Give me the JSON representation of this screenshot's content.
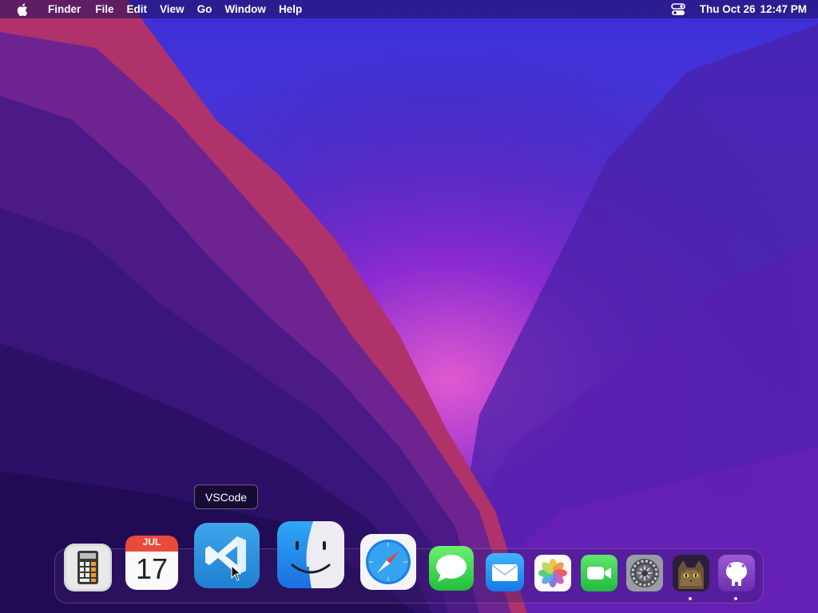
{
  "menubar": {
    "app_name": "Finder",
    "menus": [
      "File",
      "Edit",
      "View",
      "Go",
      "Window",
      "Help"
    ],
    "clock_day": "Thu Oct 26",
    "clock_time": "12:47 PM"
  },
  "tooltip": {
    "label": "VSCode"
  },
  "calendar": {
    "month": "JUL",
    "day": "17"
  },
  "dock": {
    "items": [
      {
        "name": "calculator",
        "icon": "calculator-icon"
      },
      {
        "name": "calendar",
        "icon": "calendar-icon"
      },
      {
        "name": "vscode",
        "icon": "vscode-icon"
      },
      {
        "name": "finder",
        "icon": "finder-icon"
      },
      {
        "name": "safari",
        "icon": "safari-icon"
      },
      {
        "name": "messages",
        "icon": "messages-icon"
      },
      {
        "name": "mail",
        "icon": "mail-icon"
      },
      {
        "name": "photos",
        "icon": "photos-icon"
      },
      {
        "name": "facetime",
        "icon": "facetime-icon"
      },
      {
        "name": "system-preferences",
        "icon": "gear-icon"
      },
      {
        "name": "cat-app",
        "icon": "cat-icon"
      },
      {
        "name": "github-desktop",
        "icon": "github-icon"
      }
    ]
  }
}
